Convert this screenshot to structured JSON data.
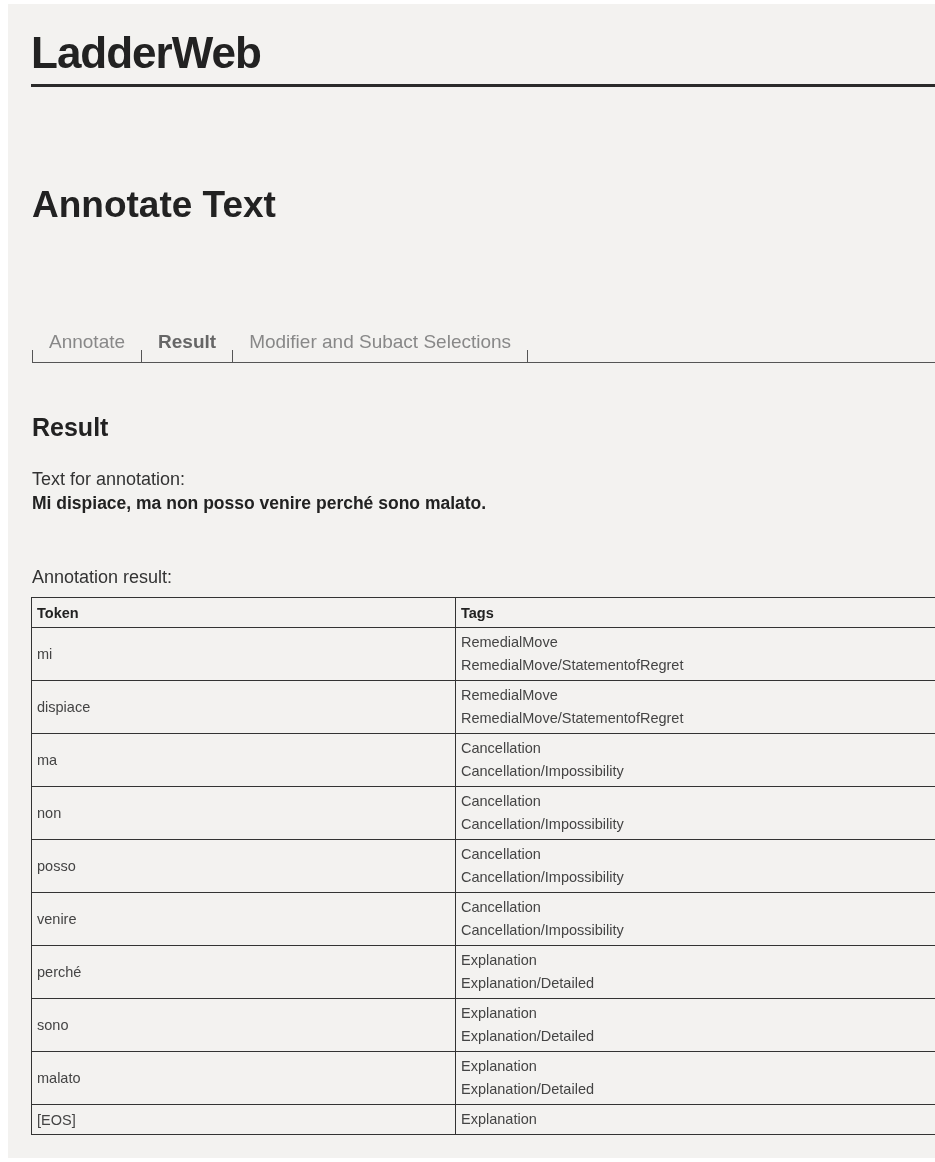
{
  "site": {
    "title": "LadderWeb"
  },
  "page": {
    "heading": "Annotate Text"
  },
  "tabs": [
    {
      "label": "Annotate",
      "selected": false
    },
    {
      "label": "Result",
      "selected": true
    },
    {
      "label": "Modifier and Subact Selections",
      "selected": false
    }
  ],
  "result": {
    "heading": "Result",
    "text_label": "Text for annotation:",
    "text": "Mi dispiace, ma non posso venire perché sono malato.",
    "result_label": "Annotation result:"
  },
  "table": {
    "columns": [
      "Token",
      "Tags"
    ],
    "rows": [
      {
        "token": "mi",
        "tags": [
          "RemedialMove",
          "RemedialMove/StatementofRegret"
        ]
      },
      {
        "token": "dispiace",
        "tags": [
          "RemedialMove",
          "RemedialMove/StatementofRegret"
        ]
      },
      {
        "token": "ma",
        "tags": [
          "Cancellation",
          "Cancellation/Impossibility"
        ]
      },
      {
        "token": "non",
        "tags": [
          "Cancellation",
          "Cancellation/Impossibility"
        ]
      },
      {
        "token": "posso",
        "tags": [
          "Cancellation",
          "Cancellation/Impossibility"
        ]
      },
      {
        "token": "venire",
        "tags": [
          "Cancellation",
          "Cancellation/Impossibility"
        ]
      },
      {
        "token": "perché",
        "tags": [
          "Explanation",
          "Explanation/Detailed"
        ]
      },
      {
        "token": "sono",
        "tags": [
          "Explanation",
          "Explanation/Detailed"
        ]
      },
      {
        "token": "malato",
        "tags": [
          "Explanation",
          "Explanation/Detailed"
        ]
      },
      {
        "token": "[EOS]",
        "tags": [
          "Explanation"
        ]
      }
    ]
  }
}
